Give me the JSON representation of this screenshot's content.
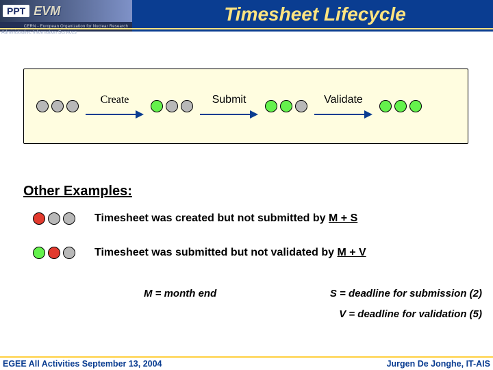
{
  "header": {
    "logo_ppt": "PPT",
    "logo_evm": "EVM",
    "cern_line": "CERN - European Organization for Nuclear Research",
    "ais_line": "Administrative Information Services",
    "title": "Timesheet Lifecycle"
  },
  "lifecycle": {
    "labels": {
      "create": "Create",
      "submit": "Submit",
      "validate": "Validate"
    },
    "traffic_lights": [
      [
        "grey",
        "grey",
        "grey"
      ],
      [
        "green",
        "grey",
        "grey"
      ],
      [
        "green",
        "green",
        "grey"
      ],
      [
        "green",
        "green",
        "green"
      ]
    ]
  },
  "examples": {
    "heading": "Other Examples:",
    "rows": [
      {
        "circles": [
          "red",
          "grey",
          "grey"
        ],
        "text_pre": "Timesheet was created but not submitted by ",
        "text_u": "M + S"
      },
      {
        "circles": [
          "green",
          "red",
          "grey"
        ],
        "text_pre": "Timesheet was submitted but not validated by ",
        "text_u": "M + V"
      }
    ]
  },
  "legend": {
    "m": "M = month end",
    "s": "S = deadline for submission (2)",
    "v": "V = deadline for validation (5)"
  },
  "footer": {
    "left": "EGEE All Activities  September 13, 2004",
    "right": "Jurgen De Jonghe, IT-AIS"
  }
}
